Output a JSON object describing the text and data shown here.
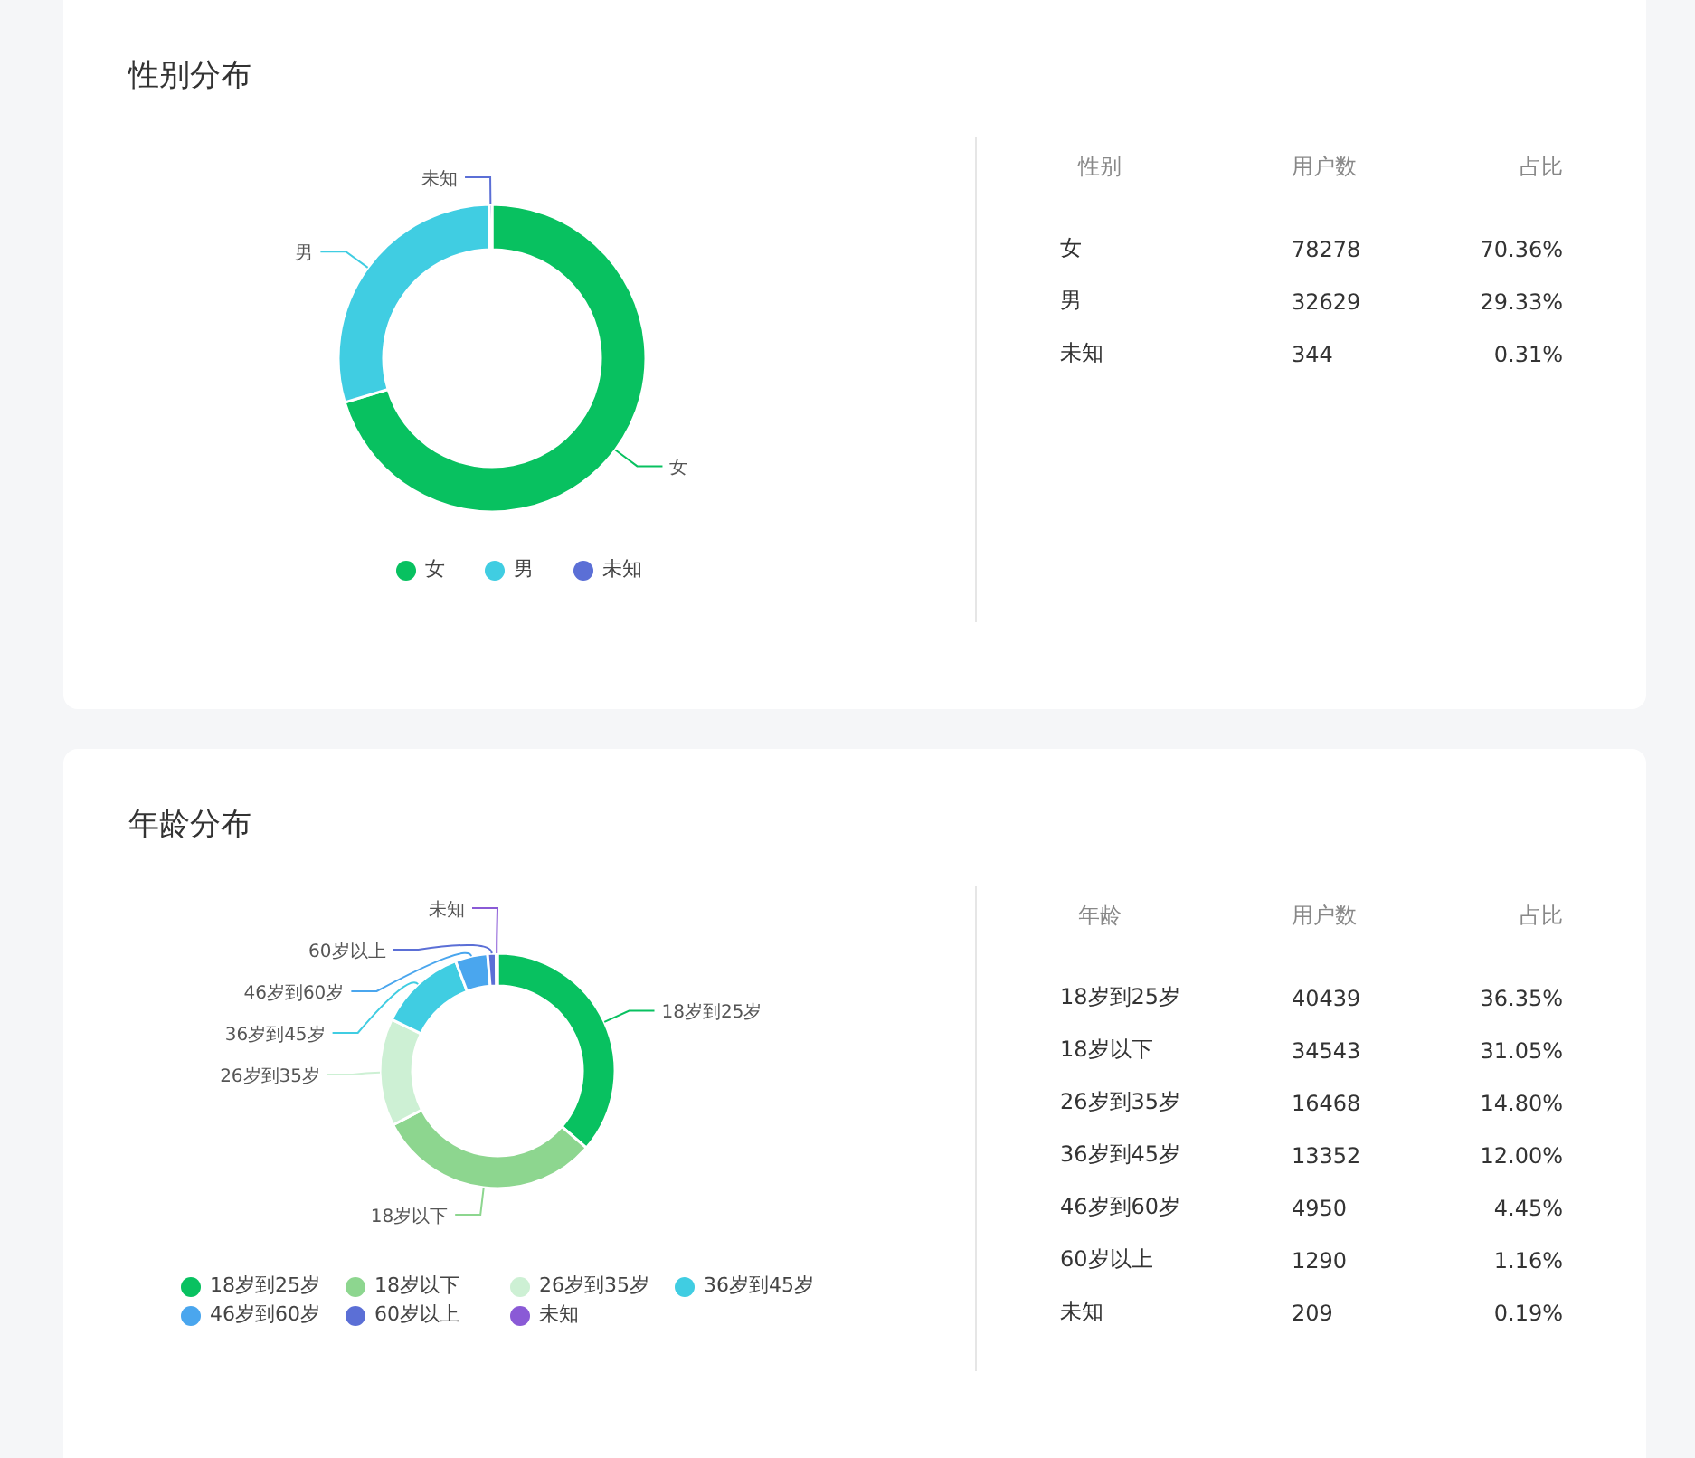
{
  "cards": [
    {
      "title": "性别分布",
      "chart": {
        "chart_data": {
          "type": "donut",
          "categories": [
            "女",
            "男",
            "未知"
          ],
          "series": [
            {
              "values": [
                70.36,
                29.33,
                0.31
              ]
            }
          ]
        }
      },
      "legend": [
        {
          "label": "女",
          "color": "#08c160"
        },
        {
          "label": "男",
          "color": "#40cde2"
        },
        {
          "label": "未知",
          "color": "#5b6fd6"
        }
      ],
      "table": {
        "columns": [
          "性别",
          "用户数",
          "占比"
        ],
        "rows": [
          {
            "name": "女",
            "count": "78278",
            "share": "70.36%"
          },
          {
            "name": "男",
            "count": "32629",
            "share": "29.33%"
          },
          {
            "name": "未知",
            "count": "344",
            "share": "0.31%"
          }
        ]
      }
    },
    {
      "title": "年龄分布",
      "chart": {
        "chart_data": {
          "type": "donut",
          "categories": [
            "18岁到25岁",
            "18岁以下",
            "26岁到35岁",
            "36岁到45岁",
            "46岁到60岁",
            "60岁以上",
            "未知"
          ],
          "series": [
            {
              "values": [
                36.35,
                31.05,
                14.8,
                12.0,
                4.45,
                1.16,
                0.19
              ]
            }
          ]
        }
      },
      "legend": [
        {
          "label": "18岁到25岁",
          "color": "#08c160"
        },
        {
          "label": "18岁以下",
          "color": "#8dd68f"
        },
        {
          "label": "26岁到35岁",
          "color": "#cdf0d4"
        },
        {
          "label": "36岁到45岁",
          "color": "#40cde2"
        },
        {
          "label": "46岁到60岁",
          "color": "#4aa6ee"
        },
        {
          "label": "60岁以上",
          "color": "#5b6fd6"
        },
        {
          "label": "未知",
          "color": "#8a5ad6"
        }
      ],
      "table": {
        "columns": [
          "年龄",
          "用户数",
          "占比"
        ],
        "rows": [
          {
            "name": "18岁到25岁",
            "count": "40439",
            "share": "36.35%"
          },
          {
            "name": "18岁以下",
            "count": "34543",
            "share": "31.05%"
          },
          {
            "name": "26岁到35岁",
            "count": "16468",
            "share": "14.80%"
          },
          {
            "name": "36岁到45岁",
            "count": "13352",
            "share": "12.00%"
          },
          {
            "name": "46岁到60岁",
            "count": "4950",
            "share": "4.45%"
          },
          {
            "name": "60岁以上",
            "count": "1290",
            "share": "1.16%"
          },
          {
            "name": "未知",
            "count": "209",
            "share": "0.19%"
          }
        ]
      }
    }
  ]
}
